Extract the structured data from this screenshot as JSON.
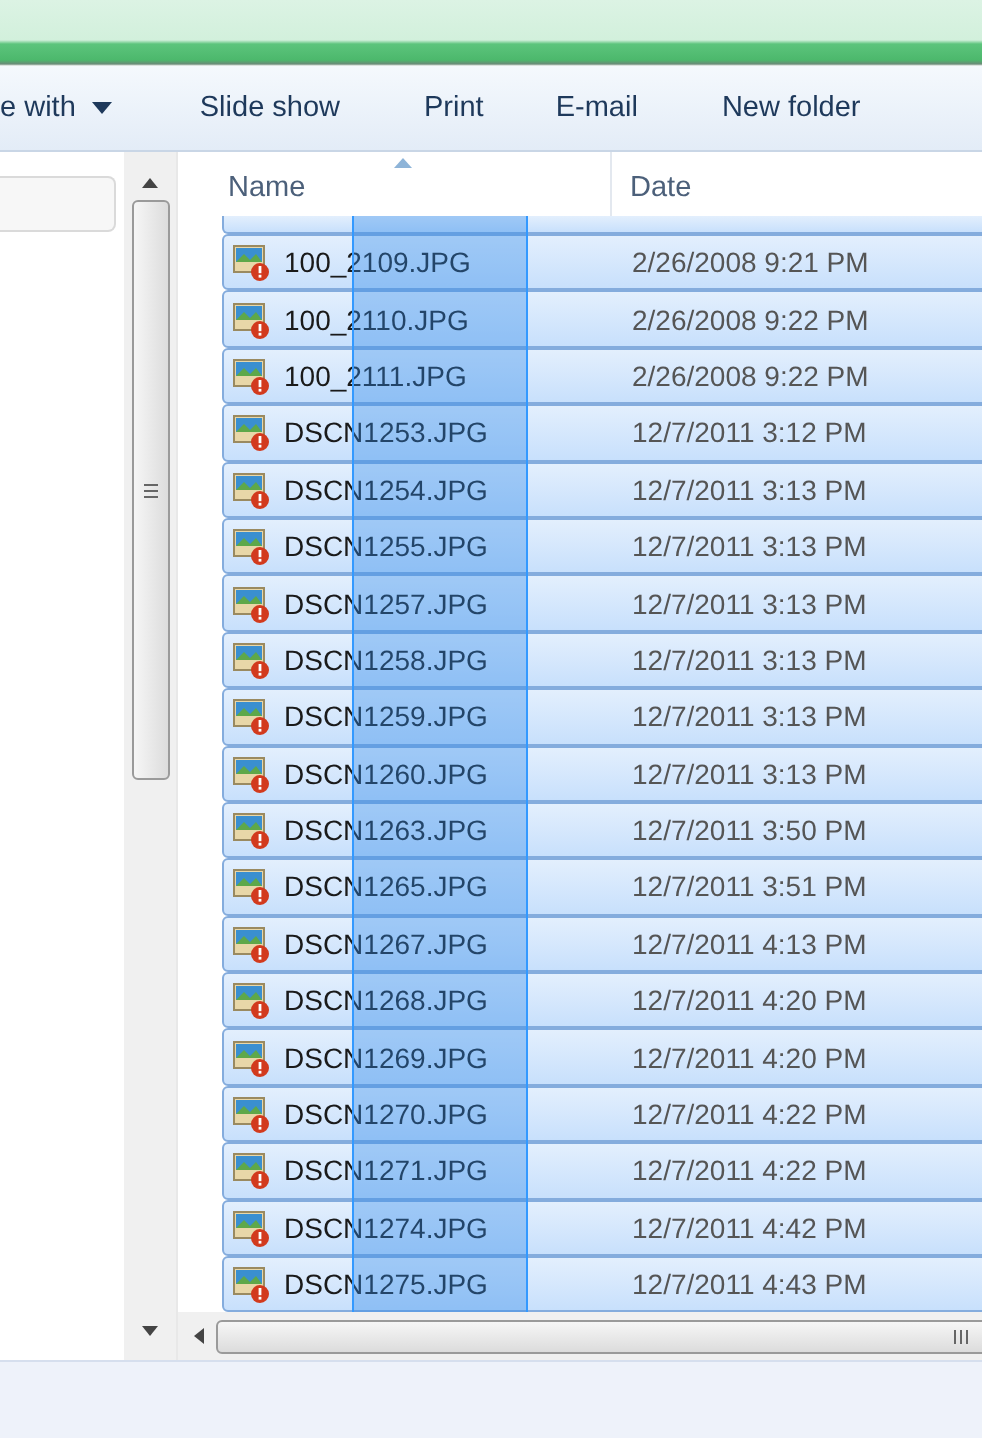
{
  "toolbar": [
    {
      "label": "e with",
      "dropdown": true
    },
    {
      "label": "Slide show",
      "dropdown": false
    },
    {
      "label": "Print",
      "dropdown": false
    },
    {
      "label": "E-mail",
      "dropdown": false
    },
    {
      "label": "New folder",
      "dropdown": false
    }
  ],
  "columns": [
    {
      "label": "Name",
      "sorted": true
    },
    {
      "label": "Date",
      "sorted": false
    }
  ],
  "partial_row": {
    "selected": true
  },
  "files": [
    {
      "name": "100_2109.JPG",
      "date": "2/26/2008 9:21 PM",
      "selected": true
    },
    {
      "name": "100_2110.JPG",
      "date": "2/26/2008 9:22 PM",
      "selected": true
    },
    {
      "name": "100_2111.JPG",
      "date": "2/26/2008 9:22 PM",
      "selected": true
    },
    {
      "name": "DSCN1253.JPG",
      "date": "12/7/2011 3:12 PM",
      "selected": true
    },
    {
      "name": "DSCN1254.JPG",
      "date": "12/7/2011 3:13 PM",
      "selected": true
    },
    {
      "name": "DSCN1255.JPG",
      "date": "12/7/2011 3:13 PM",
      "selected": true
    },
    {
      "name": "DSCN1257.JPG",
      "date": "12/7/2011 3:13 PM",
      "selected": true
    },
    {
      "name": "DSCN1258.JPG",
      "date": "12/7/2011 3:13 PM",
      "selected": true
    },
    {
      "name": "DSCN1259.JPG",
      "date": "12/7/2011 3:13 PM",
      "selected": true
    },
    {
      "name": "DSCN1260.JPG",
      "date": "12/7/2011 3:13 PM",
      "selected": true
    },
    {
      "name": "DSCN1263.JPG",
      "date": "12/7/2011 3:50 PM",
      "selected": true
    },
    {
      "name": "DSCN1265.JPG",
      "date": "12/7/2011 3:51 PM",
      "selected": true
    },
    {
      "name": "DSCN1267.JPG",
      "date": "12/7/2011 4:13 PM",
      "selected": true
    },
    {
      "name": "DSCN1268.JPG",
      "date": "12/7/2011 4:20 PM",
      "selected": true
    },
    {
      "name": "DSCN1269.JPG",
      "date": "12/7/2011 4:20 PM",
      "selected": true
    },
    {
      "name": "DSCN1270.JPG",
      "date": "12/7/2011 4:22 PM",
      "selected": true
    },
    {
      "name": "DSCN1271.JPG",
      "date": "12/7/2011 4:22 PM",
      "selected": true
    },
    {
      "name": "DSCN1274.JPG",
      "date": "12/7/2011 4:42 PM",
      "selected": true
    },
    {
      "name": "DSCN1275.JPG",
      "date": "12/7/2011 4:43 PM",
      "selected": true
    }
  ]
}
